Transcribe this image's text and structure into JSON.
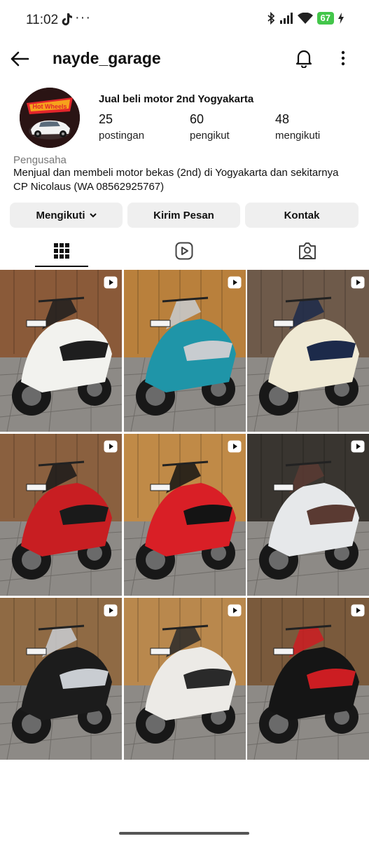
{
  "status_bar": {
    "time": "11:02",
    "dots": "···",
    "battery": "67",
    "battery_color": "#43c64a"
  },
  "header": {
    "username": "nayde_garage",
    "icons": [
      "back-arrow-icon",
      "bell-icon",
      "more-vertical-icon"
    ]
  },
  "profile": {
    "avatar_logo_text": "Hot Wheels",
    "title": "Jual beli motor 2nd Yogyakarta",
    "stats": [
      {
        "value": "25",
        "label": "postingan"
      },
      {
        "value": "60",
        "label": "pengikut"
      },
      {
        "value": "48",
        "label": "mengikuti"
      }
    ],
    "category": "Pengusaha",
    "bio_lines": [
      "Menjual dan membeli motor bekas (2nd) di Yogyakarta dan sekitarnya",
      "CP Nicolaus (WA 08562925767)"
    ]
  },
  "actions": {
    "follow_label": "Mengikuti",
    "message_label": "Kirim Pesan",
    "contact_label": "Kontak"
  },
  "tabs": [
    {
      "icon": "grid-icon",
      "active": true
    },
    {
      "icon": "reels-icon",
      "active": false
    },
    {
      "icon": "tagged-icon",
      "active": false
    }
  ],
  "posts": [
    {
      "type": "reel",
      "body_color": "#f2f2ee",
      "accent": "#1e1e1e",
      "bg": "#8a5a3a"
    },
    {
      "type": "reel",
      "body_color": "#1f95a8",
      "accent": "#c8ccd0",
      "bg": "#b9803c"
    },
    {
      "type": "reel",
      "body_color": "#efe9d4",
      "accent": "#1c2a4a",
      "bg": "#6e5a4a"
    },
    {
      "type": "reel",
      "body_color": "#c81e22",
      "accent": "#1a1a1a",
      "bg": "#8a6040"
    },
    {
      "type": "reel",
      "body_color": "#d91f26",
      "accent": "#141414",
      "bg": "#c08a48"
    },
    {
      "type": "reel",
      "body_color": "#e6e8ea",
      "accent": "#5a3a32",
      "bg": "#3a3530"
    },
    {
      "type": "reel",
      "body_color": "#1c1c1c",
      "accent": "#c9cdd2",
      "bg": "#8f6a44"
    },
    {
      "type": "reel",
      "body_color": "#eceae6",
      "accent": "#2a2a2a",
      "bg": "#b9884e"
    },
    {
      "type": "reel",
      "body_color": "#151515",
      "accent": "#cc1d22",
      "bg": "#7a5a3c"
    }
  ]
}
